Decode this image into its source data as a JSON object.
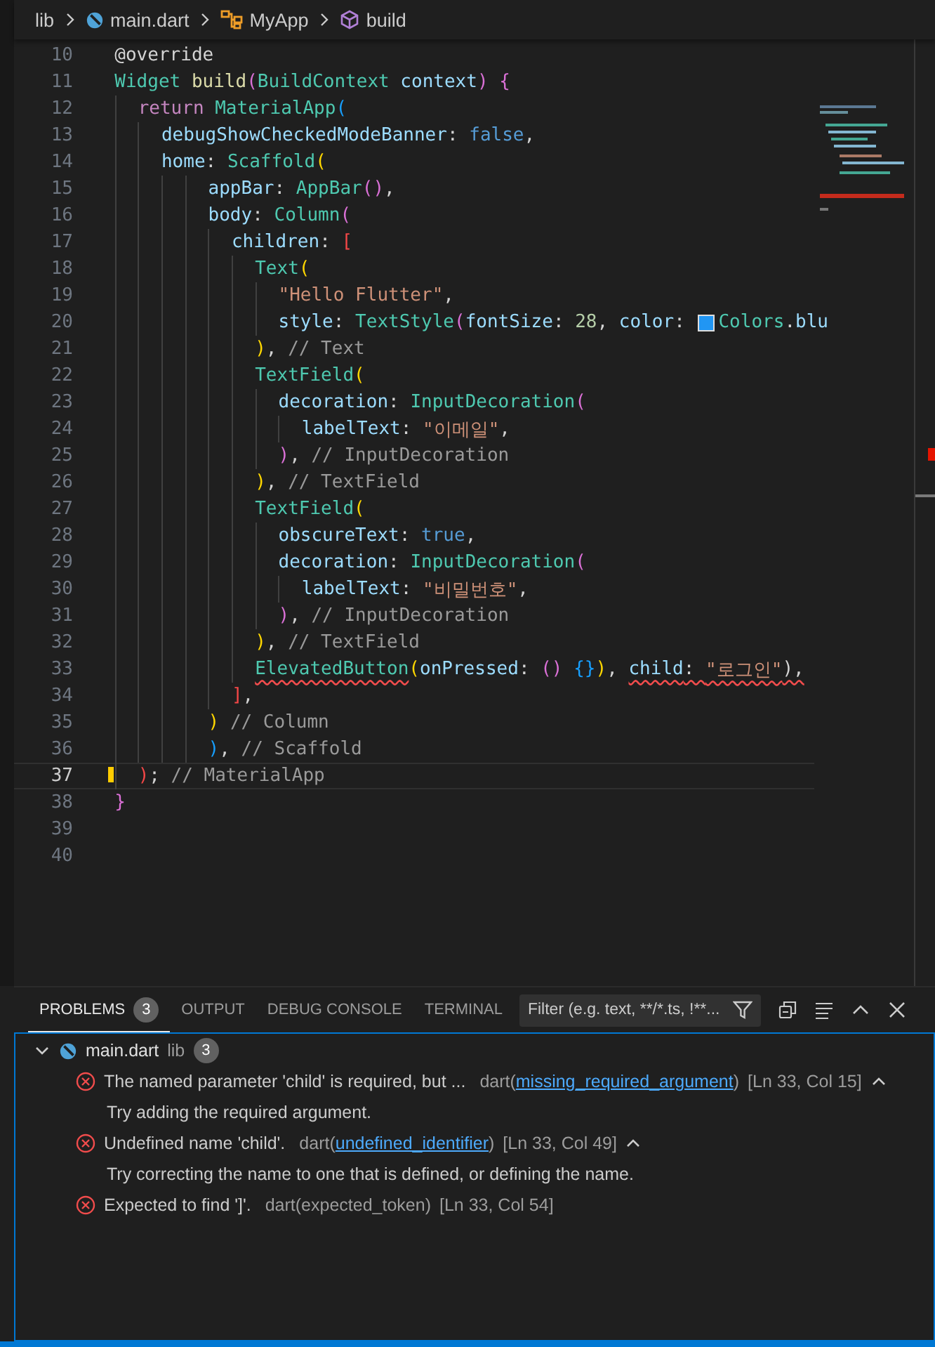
{
  "breadcrumb": [
    {
      "kind": "folder",
      "label": "lib"
    },
    {
      "kind": "dart-file",
      "label": "main.dart"
    },
    {
      "kind": "class",
      "label": "MyApp"
    },
    {
      "kind": "method",
      "label": "build"
    }
  ],
  "editor": {
    "lines": [
      {
        "number": "10",
        "current": false,
        "tokens": [
          {
            "kind": "p",
            "text": "  @override"
          }
        ]
      },
      {
        "number": "11",
        "current": false,
        "tokens": [
          {
            "kind": "type",
            "text": "  Widget "
          },
          {
            "kind": "fn",
            "text": "build"
          },
          {
            "kind": "b2",
            "text": "("
          },
          {
            "kind": "type",
            "text": "BuildContext "
          },
          {
            "kind": "prop",
            "text": "context"
          },
          {
            "kind": "b2",
            "text": ") {"
          }
        ]
      },
      {
        "number": "12",
        "current": false,
        "tokens": [
          {
            "kind": "kw",
            "text": "    return "
          },
          {
            "kind": "type",
            "text": "MaterialApp"
          },
          {
            "kind": "b3",
            "text": "("
          }
        ]
      },
      {
        "number": "13",
        "current": false,
        "tokens": [
          {
            "kind": "prop",
            "text": "      debugShowCheckedModeBanner"
          },
          {
            "kind": "p",
            "text": ": "
          },
          {
            "kind": "kw2",
            "text": "false"
          },
          {
            "kind": "p",
            "text": ","
          }
        ]
      },
      {
        "number": "14",
        "current": false,
        "tokens": [
          {
            "kind": "prop",
            "text": "      home"
          },
          {
            "kind": "p",
            "text": ": "
          },
          {
            "kind": "type",
            "text": "Scaffold"
          },
          {
            "kind": "b1",
            "text": "("
          }
        ]
      },
      {
        "number": "15",
        "current": false,
        "tokens": [
          {
            "kind": "prop",
            "text": "          appBar"
          },
          {
            "kind": "p",
            "text": ": "
          },
          {
            "kind": "type",
            "text": "AppBar"
          },
          {
            "kind": "b2",
            "text": "()"
          },
          {
            "kind": "p",
            "text": ","
          }
        ]
      },
      {
        "number": "16",
        "current": false,
        "tokens": [
          {
            "kind": "prop",
            "text": "          body"
          },
          {
            "kind": "p",
            "text": ": "
          },
          {
            "kind": "type",
            "text": "Column"
          },
          {
            "kind": "b2",
            "text": "("
          }
        ]
      },
      {
        "number": "17",
        "current": false,
        "tokens": [
          {
            "kind": "prop",
            "text": "            children"
          },
          {
            "kind": "p",
            "text": ": "
          },
          {
            "kind": "bx",
            "text": "["
          }
        ]
      },
      {
        "number": "18",
        "current": false,
        "tokens": [
          {
            "kind": "type",
            "text": "              Text"
          },
          {
            "kind": "b1",
            "text": "("
          }
        ]
      },
      {
        "number": "19",
        "current": false,
        "tokens": [
          {
            "kind": "str",
            "text": "                \"Hello Flutter\""
          },
          {
            "kind": "p",
            "text": ","
          }
        ]
      },
      {
        "number": "20",
        "current": false,
        "tokens": [
          {
            "kind": "prop",
            "text": "                style"
          },
          {
            "kind": "p",
            "text": ": "
          },
          {
            "kind": "type",
            "text": "TextStyle"
          },
          {
            "kind": "b2",
            "text": "("
          },
          {
            "kind": "prop",
            "text": "fontSize"
          },
          {
            "kind": "p",
            "text": ": "
          },
          {
            "kind": "num",
            "text": "28"
          },
          {
            "kind": "p",
            "text": ", "
          },
          {
            "kind": "prop",
            "text": "color"
          },
          {
            "kind": "p",
            "text": ": "
          },
          {
            "kind": "swatch",
            "color": "#2196f3"
          },
          {
            "kind": "type",
            "text": "Colors"
          },
          {
            "kind": "p",
            "text": "."
          },
          {
            "kind": "prop",
            "text": "blu"
          }
        ]
      },
      {
        "number": "21",
        "current": false,
        "tokens": [
          {
            "kind": "b1",
            "text": "              )"
          },
          {
            "kind": "p",
            "text": ", "
          },
          {
            "kind": "cmt",
            "text": "// Text"
          }
        ]
      },
      {
        "number": "22",
        "current": false,
        "tokens": [
          {
            "kind": "type",
            "text": "              TextField"
          },
          {
            "kind": "b1",
            "text": "("
          }
        ]
      },
      {
        "number": "23",
        "current": false,
        "tokens": [
          {
            "kind": "prop",
            "text": "                decoration"
          },
          {
            "kind": "p",
            "text": ": "
          },
          {
            "kind": "type",
            "text": "InputDecoration"
          },
          {
            "kind": "b2",
            "text": "("
          }
        ]
      },
      {
        "number": "24",
        "current": false,
        "tokens": [
          {
            "kind": "prop",
            "text": "                  labelText"
          },
          {
            "kind": "p",
            "text": ": "
          },
          {
            "kind": "str",
            "text": "\"이메일\""
          },
          {
            "kind": "p",
            "text": ","
          }
        ]
      },
      {
        "number": "25",
        "current": false,
        "tokens": [
          {
            "kind": "b2",
            "text": "                )"
          },
          {
            "kind": "p",
            "text": ", "
          },
          {
            "kind": "cmt",
            "text": "// InputDecoration"
          }
        ]
      },
      {
        "number": "26",
        "current": false,
        "tokens": [
          {
            "kind": "b1",
            "text": "              )"
          },
          {
            "kind": "p",
            "text": ", "
          },
          {
            "kind": "cmt",
            "text": "// TextField"
          }
        ]
      },
      {
        "number": "27",
        "current": false,
        "tokens": [
          {
            "kind": "type",
            "text": "              TextField"
          },
          {
            "kind": "b1",
            "text": "("
          }
        ]
      },
      {
        "number": "28",
        "current": false,
        "tokens": [
          {
            "kind": "prop",
            "text": "                obscureText"
          },
          {
            "kind": "p",
            "text": ": "
          },
          {
            "kind": "kw2",
            "text": "true"
          },
          {
            "kind": "p",
            "text": ","
          }
        ]
      },
      {
        "number": "29",
        "current": false,
        "tokens": [
          {
            "kind": "prop",
            "text": "                decoration"
          },
          {
            "kind": "p",
            "text": ": "
          },
          {
            "kind": "type",
            "text": "InputDecoration"
          },
          {
            "kind": "b2",
            "text": "("
          }
        ]
      },
      {
        "number": "30",
        "current": false,
        "tokens": [
          {
            "kind": "prop",
            "text": "                  labelText"
          },
          {
            "kind": "p",
            "text": ": "
          },
          {
            "kind": "str",
            "text": "\"비밀번호\""
          },
          {
            "kind": "p",
            "text": ","
          }
        ]
      },
      {
        "number": "31",
        "current": false,
        "tokens": [
          {
            "kind": "b2",
            "text": "                )"
          },
          {
            "kind": "p",
            "text": ", "
          },
          {
            "kind": "cmt",
            "text": "// InputDecoration"
          }
        ]
      },
      {
        "number": "32",
        "current": false,
        "tokens": [
          {
            "kind": "b1",
            "text": "              )"
          },
          {
            "kind": "p",
            "text": ", "
          },
          {
            "kind": "cmt",
            "text": "// TextField"
          }
        ]
      },
      {
        "number": "33",
        "current": false,
        "tokens": [
          {
            "kind": "type",
            "text": "              ElevatedButton",
            "error": true
          },
          {
            "kind": "b1",
            "text": "("
          },
          {
            "kind": "prop",
            "text": "onPressed"
          },
          {
            "kind": "p",
            "text": ": "
          },
          {
            "kind": "b2",
            "text": "() "
          },
          {
            "kind": "b3",
            "text": "{}"
          },
          {
            "kind": "b1",
            "text": ")"
          },
          {
            "kind": "p",
            "text": ", "
          },
          {
            "kind": "prop",
            "text": "child",
            "error": true
          },
          {
            "kind": "p",
            "text": ": ",
            "error": true
          },
          {
            "kind": "str",
            "text": "\"로그인\"",
            "error": true
          },
          {
            "kind": "p",
            "text": "),",
            "error": true
          }
        ]
      },
      {
        "number": "34",
        "current": false,
        "tokens": [
          {
            "kind": "bx",
            "text": "            ]"
          },
          {
            "kind": "p",
            "text": ","
          }
        ]
      },
      {
        "number": "35",
        "current": false,
        "tokens": [
          {
            "kind": "b1",
            "text": "          ) "
          },
          {
            "kind": "cmt",
            "text": "// Column"
          }
        ]
      },
      {
        "number": "36",
        "current": false,
        "tokens": [
          {
            "kind": "b3",
            "text": "          )"
          },
          {
            "kind": "p",
            "text": ", "
          },
          {
            "kind": "cmt",
            "text": "// Scaffold"
          }
        ]
      },
      {
        "number": "37",
        "current": true,
        "tokens": [
          {
            "kind": "bx",
            "text": "    )"
          },
          {
            "kind": "p",
            "text": "; "
          },
          {
            "kind": "cmt",
            "text": "// MaterialApp"
          }
        ]
      },
      {
        "number": "38",
        "current": false,
        "tokens": [
          {
            "kind": "b2",
            "text": "  }"
          }
        ]
      },
      {
        "number": "39",
        "current": false
      },
      {
        "number": "40",
        "current": false
      }
    ]
  },
  "panel": {
    "tabs": [
      {
        "label": "PROBLEMS",
        "badge": "3",
        "selected": true
      },
      {
        "label": "OUTPUT",
        "selected": false
      },
      {
        "label": "DEBUG CONSOLE",
        "selected": false
      },
      {
        "label": "TERMINAL",
        "selected": false
      }
    ],
    "filter": {
      "placeholder": "Filter (e.g. text, **/*.ts, !**..."
    },
    "problems": {
      "file": "main.dart",
      "folder": "lib",
      "count": "3",
      "expanded": true,
      "items": [
        {
          "message": "The named parameter 'child' is required, but ...",
          "source": "dart(",
          "code": "missing_required_argument",
          "code_link": true,
          "close": ")",
          "location": "[Ln 33, Col 15]",
          "expanded": true,
          "detail": "Try adding the required argument."
        },
        {
          "message": "Undefined name 'child'.",
          "source": "dart(",
          "code": "undefined_identifier",
          "code_link": true,
          "close": ")",
          "location": "[Ln 33, Col 49]",
          "expanded": true,
          "detail": "Try correcting the name to one that is defined, or defining the name."
        },
        {
          "message": "Expected to find ']'.",
          "source": "dart(",
          "code": "expected_token",
          "code_link": false,
          "close": ")",
          "location": "[Ln 33, Col 54]"
        }
      ]
    }
  }
}
